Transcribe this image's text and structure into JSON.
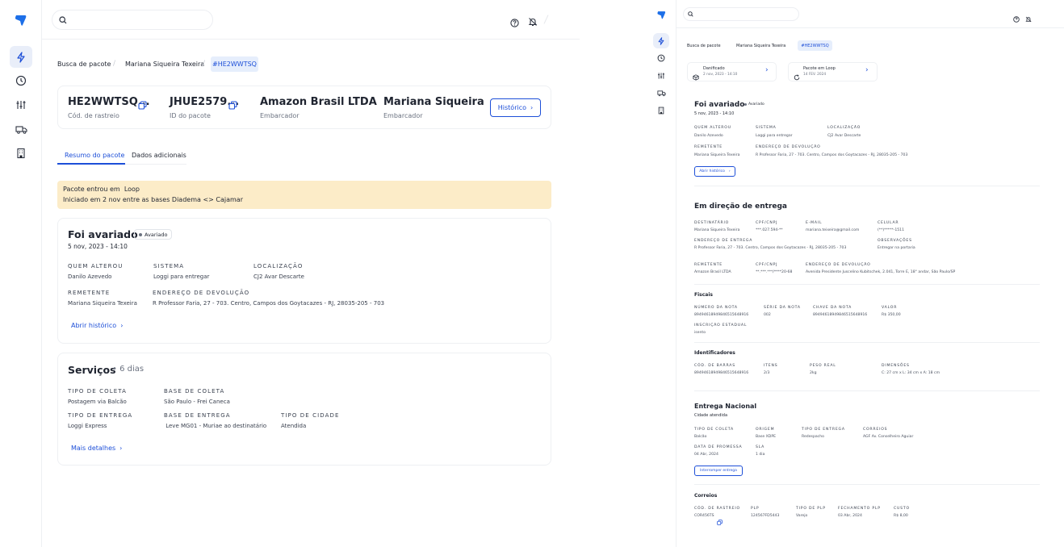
{
  "left": {
    "breadcrumb": [
      "Busca de pacote",
      "Mariana Siqueira Texeira",
      "#HE2WWTSQ"
    ],
    "summary": [
      {
        "value": "HE2WWTSQ...",
        "label": "Cód. de rastreio"
      },
      {
        "value": "JHUE2579...",
        "label": "ID do pacote"
      },
      {
        "value": "Amazon Brasil LTDA",
        "label": "Embarcador"
      },
      {
        "value": "Mariana Siqueira",
        "label": "Embarcador"
      }
    ],
    "historico_btn": "Histórico",
    "tabs": [
      "Resumo do pacote",
      "Dados adicionais"
    ],
    "alert": {
      "line1": "Pacote entrou em  Loop",
      "line2": "Iniciado em 2 nov entre as bases Diadema <> Cajamar"
    },
    "avariado": {
      "title": "Foi avariado",
      "badge": "Avariado",
      "date": "5 nov, 2023 - 14:10",
      "fields": [
        {
          "label": "QUEM ALTEROU",
          "value": "Danilo Azevedo"
        },
        {
          "label": "SISTEMA",
          "value": "Loggi para entregar"
        },
        {
          "label": "LOCALIZAÇÃO",
          "value": "CJ2 Avar Descarte"
        },
        {
          "label": "REMETENTE",
          "value": "Mariana Siqueira Texeira"
        },
        {
          "label": "ENDEREÇO DE DEVOLUÇÃO",
          "value": "R Professor Faria, 27 - 703. Centro, Campos dos Goytacazes - RJ, 28035-205 - 703"
        }
      ],
      "link": "Abrir histórico"
    },
    "servicos": {
      "title": "Serviços",
      "days": "• 6 dias",
      "fields": [
        {
          "label": "TIPO DE COLETA",
          "value": "Postagem via Balcão"
        },
        {
          "label": "BASE DE COLETA",
          "value": "São Paulo - Frei Caneca"
        },
        {
          "label": "TIPO DE ENTREGA",
          "value": "Loggi Express"
        },
        {
          "label": "BASE DE ENTREGA",
          "value": " Leve MG01 - Muriae ao destinatário"
        },
        {
          "label": "TIPO DE CIDADE",
          "value": "Atendida"
        }
      ],
      "link": "Mais detalhes"
    }
  },
  "right": {
    "breadcrumb": [
      "Busca de pacote",
      "Mariana Siqueira Texeira",
      "#HE2WWTSQ"
    ],
    "events": [
      {
        "title": "Danificado",
        "date": "2 nov, 2023 - 14:10"
      },
      {
        "title": "Pacote em Loop",
        "date": "14 FEV. 2024"
      }
    ],
    "avariado": {
      "title": "Foi avariado",
      "badge": "Avariado",
      "date": "5 nov, 2023 - 14:10",
      "fields": [
        {
          "label": "QUEM ALTEROU",
          "value": "Danilo Azevedo"
        },
        {
          "label": "SISTEMA",
          "value": "Loggi para entregar"
        },
        {
          "label": "LOCALIZAÇÃO",
          "value": "CJ2 Avar Descarte"
        },
        {
          "label": "REMETENTE",
          "value": "Mariana Siqueira Texeira"
        },
        {
          "label": "ENDEREÇO DE DEVOLUÇÃO",
          "value": "R Professor Faria, 27 - 703. Centro, Campos dos Goytacazes - RJ, 28035-205 - 703"
        }
      ],
      "btn": "Abrir histórico"
    },
    "direcao": {
      "title": "Em direção de entrega",
      "fields": [
        {
          "label": "DESTINATÁRIO",
          "value": "Mariana Siqueira Texeira"
        },
        {
          "label": "CPF/CNPJ",
          "value": "***.027.594-**"
        },
        {
          "label": "E-MAIL",
          "value": "mariana.teixeira@gmail.com"
        },
        {
          "label": "CELULAR",
          "value": "(**)*****-1511"
        },
        {
          "label": "ENDEREÇO DE ENTREGA",
          "value": "R Professor Faria, 27 - 703. Centro, Campos dos Goytacazes - RJ, 28035-205 - 703"
        },
        {
          "label": "OBSERVAÇÕES",
          "value": "Entregar na portaria"
        },
        {
          "label": "REMETENTE",
          "value": "Amazon Brasil LTDA"
        },
        {
          "label": "CPF/CNPJ",
          "value": "**.***.***/****20-68"
        },
        {
          "label": "ENDEREÇO DE DEVOLUÇÃO",
          "value": "Avenida Presidente Juscelino Kubitschek, 2.041, Torre E, 18° andar, São Paulo/SP"
        }
      ]
    },
    "fiscais": {
      "title": "Fiscais",
      "fields": [
        {
          "label": "NÚMERO DA NOTA",
          "value": "89494618949846515648916"
        },
        {
          "label": "SÉRIE DA NOTA",
          "value": "002"
        },
        {
          "label": "CHAVE DA NOTA",
          "value": "89494618949846515648916"
        },
        {
          "label": "VALOR",
          "value": "R$ 350,00"
        },
        {
          "label": "INSCRIÇÃO ESTADUAL",
          "value": "isento"
        }
      ]
    },
    "identificadores": {
      "title": "Identificadores",
      "fields": [
        {
          "label": "CÓD. DE BARRAS",
          "value": "89494618949846515648916"
        },
        {
          "label": "ITENS",
          "value": "2/3"
        },
        {
          "label": "PESO REAL",
          "value": "2kg"
        },
        {
          "label": "DIMENSÕES",
          "value": "C: 27 cm x L: 34 cm x A: 18 cm"
        }
      ]
    },
    "nacional": {
      "title": "Entrega Nacional",
      "subtitle": "Cidade atendida",
      "fields": [
        {
          "label": "TIPO DE COLETA",
          "value": "Balcão"
        },
        {
          "label": "ORIGEM",
          "value": "Base XDPE"
        },
        {
          "label": "TIPO DE ENTREGA",
          "value": "Redespacho"
        },
        {
          "label": "CORREIOS",
          "value": "AGF Av. Conselheiro Aguiar"
        },
        {
          "label": "DATA DE PROMESSA",
          "value": "04 Abr, 2024"
        },
        {
          "label": "SLA",
          "value": "1 dia"
        }
      ],
      "btn": "Interromper entrega"
    },
    "correios": {
      "title": "Correios",
      "fields": [
        {
          "label": "CÓD. DE RASTREIO",
          "value": "COR456TS"
        },
        {
          "label": "PLP",
          "value": "124567FD5443"
        },
        {
          "label": "TIPO DE PLP",
          "value": "Varejo"
        },
        {
          "label": "FECHAMENTO PLP",
          "value": "03 Abr, 2024"
        },
        {
          "label": "CUSTO",
          "value": "R$ 8,00"
        }
      ]
    }
  }
}
